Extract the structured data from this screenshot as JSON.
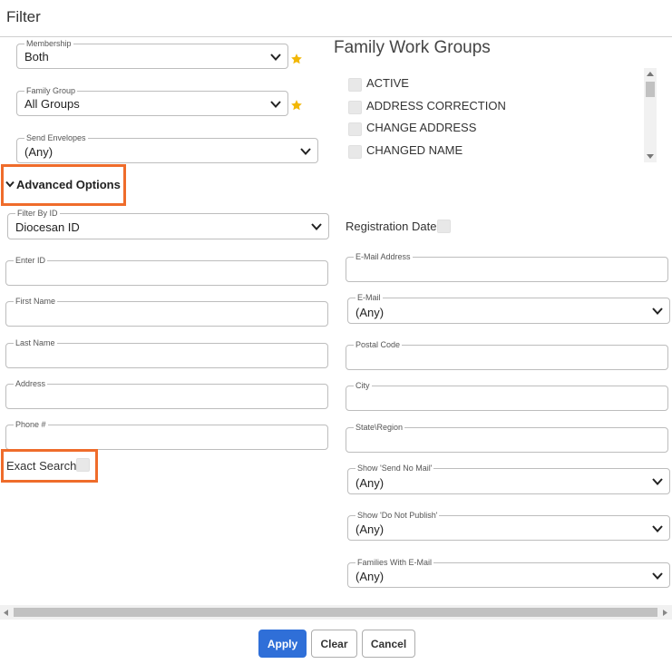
{
  "dialog": {
    "title": "Filter"
  },
  "membership": {
    "label": "Membership",
    "value": "Both"
  },
  "family_group": {
    "label": "Family Group",
    "value": "All Groups"
  },
  "send_envelopes": {
    "label": "Send Envelopes",
    "value": "(Any)"
  },
  "family_work_groups": {
    "title": "Family Work Groups",
    "items": [
      "ACTIVE",
      "ADDRESS CORRECTION",
      "CHANGE ADDRESS",
      "CHANGED NAME"
    ]
  },
  "advanced": {
    "label": "Advanced Options"
  },
  "filter_by_id": {
    "label": "Filter By ID",
    "value": "Diocesan ID"
  },
  "registration_date": {
    "label": "Registration Date"
  },
  "left_fields": {
    "enter_id": "Enter ID",
    "first_name": "First Name",
    "last_name": "Last Name",
    "address": "Address",
    "phone": "Phone #"
  },
  "exact_search": {
    "label": "Exact Search"
  },
  "right_fields": {
    "email_address": "E-Mail Address",
    "email": {
      "label": "E-Mail",
      "value": "(Any)"
    },
    "postal_code": "Postal Code",
    "city": "City",
    "state_region": "State\\Region",
    "send_no_mail": {
      "label": "Show 'Send No Mail'",
      "value": "(Any)"
    },
    "do_not_publish": {
      "label": "Show 'Do Not Publish'",
      "value": "(Any)"
    },
    "families_with_email": {
      "label": "Families With E-Mail",
      "value": "(Any)"
    }
  },
  "footer": {
    "apply": "Apply",
    "clear": "Clear",
    "cancel": "Cancel"
  },
  "colors": {
    "primary": "#2f6fd8",
    "highlight": "#ef6c2b",
    "star": "#f2b705"
  }
}
